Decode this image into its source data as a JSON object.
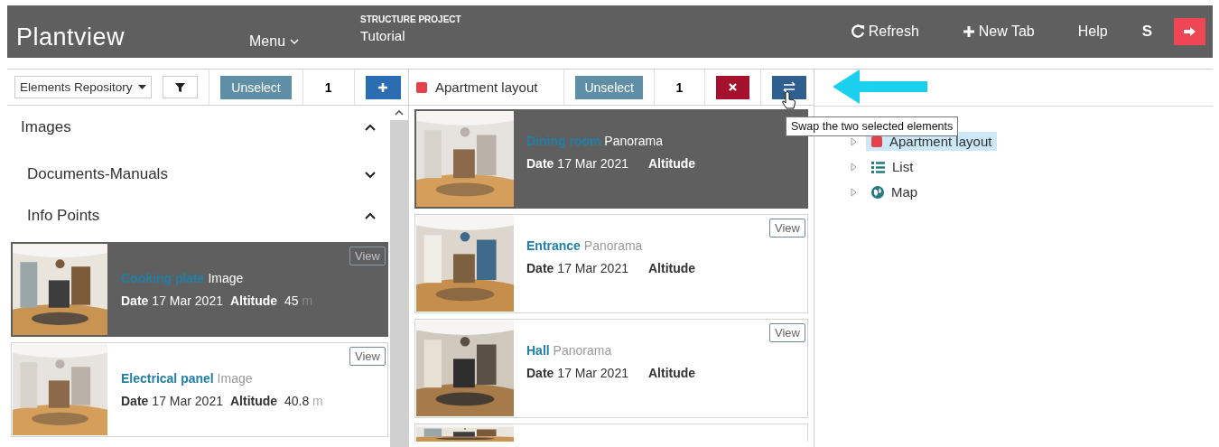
{
  "header": {
    "brand": "Plantview",
    "menu": "Menu",
    "project_label": "STRUCTURE PROJECT",
    "project_name": "Tutorial",
    "actions": [
      {
        "kind": "refresh",
        "label": "Refresh"
      },
      {
        "kind": "add",
        "label": "New Tab"
      },
      {
        "kind": "plain",
        "label": "Help"
      }
    ],
    "user": "S"
  },
  "left_toolbar": {
    "repository": "Elements Repository",
    "unselect": "Unselect",
    "count": "1"
  },
  "middle_toolbar": {
    "layer": {
      "label": "Apartment layout",
      "color": "#e8404a"
    },
    "unselect": "Unselect",
    "count": "1"
  },
  "tooltip": "Swap the two selected elements",
  "left_panel": {
    "sections": [
      {
        "title": "Images",
        "expanded": true,
        "children": [
          {
            "title": "Documents-Manuals",
            "expanded": false
          },
          {
            "title": "Info Points",
            "expanded": true,
            "cards": [
              {
                "title": "Cooking plate",
                "type": "Image",
                "date_label": "Date",
                "date": "17 Mar 2021",
                "altitude_label": "Altitude",
                "altitude": "45",
                "unit": "m",
                "view": "View",
                "selected": true
              },
              {
                "title": "Electrical panel",
                "type": "Image",
                "date_label": "Date",
                "date": "17 Mar 2021",
                "altitude_label": "Altitude",
                "altitude": "40.8",
                "unit": "m",
                "view": "View",
                "selected": false
              }
            ]
          }
        ]
      }
    ]
  },
  "middle_panel": {
    "cards": [
      {
        "title": "Dining room",
        "type": "Panorama",
        "date_label": "Date",
        "date": "17 Mar 2021",
        "altitude_label": "Altitude",
        "selected": true
      },
      {
        "title": "Entrance",
        "type": "Panorama",
        "date_label": "Date",
        "date": "17 Mar 2021",
        "altitude_label": "Altitude",
        "view": "View",
        "selected": false
      },
      {
        "title": "Hall",
        "type": "Panorama",
        "date_label": "Date",
        "date": "17 Mar 2021",
        "altitude_label": "Altitude",
        "view": "View",
        "selected": false
      },
      {
        "kind": "partial"
      }
    ]
  },
  "tree": [
    {
      "kind": "layer",
      "label": "Apartment layout",
      "color": "#e8404a",
      "selected": true
    },
    {
      "kind": "list",
      "label": "List",
      "selected": false
    },
    {
      "kind": "map",
      "label": "Map",
      "selected": false
    }
  ]
}
